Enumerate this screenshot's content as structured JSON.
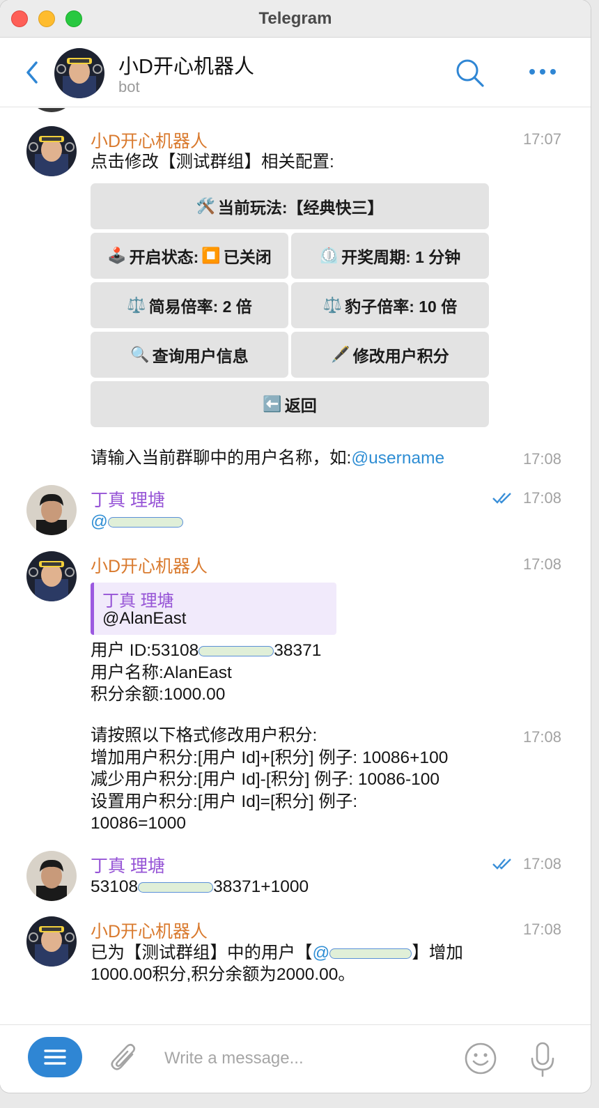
{
  "window": {
    "title": "Telegram"
  },
  "header": {
    "name": "小D开心机器人",
    "status": "bot"
  },
  "messages": {
    "m1": {
      "sender": "小D开心机器人",
      "time": "17:07",
      "text": "点击修改【测试群组】相关配置:",
      "keyboard": {
        "b1": {
          "icon": "🛠️",
          "label": "当前玩法:【经典快三】"
        },
        "b2": {
          "icon": "🕹️",
          "label": "开启状态: ",
          "icon2": "⏹️",
          "label2": "已关闭"
        },
        "b3": {
          "icon": "⏲️",
          "label": "开奖周期: 1 分钟"
        },
        "b4": {
          "icon": "⚖️",
          "label": "简易倍率: 2 倍"
        },
        "b5": {
          "icon": "⚖️",
          "label": "豹子倍率: 10 倍"
        },
        "b6": {
          "icon": "🔍",
          "label": "查询用户信息"
        },
        "b7": {
          "icon": "🖋️",
          "label": "修改用户积分"
        },
        "b8": {
          "icon": "⬅️",
          "label": "返回"
        }
      }
    },
    "m2": {
      "time": "17:08",
      "text": "请输入当前群聊中的用户名称，如:",
      "link": "@username"
    },
    "m3": {
      "sender": "丁真 理塘",
      "time": "17:08",
      "text": "@"
    },
    "m4": {
      "sender": "小D开心机器人",
      "time": "17:08",
      "quote_name": "丁真 理塘",
      "quote_text": "@AlanEast",
      "line1_a": "用户 ID:53108",
      "line1_b": "38371",
      "line2": "用户名称:AlanEast",
      "line3": "积分余额:1000.00"
    },
    "m5": {
      "time": "17:08",
      "lines": [
        "请按照以下格式修改用户积分:",
        "增加用户积分:[用户 Id]+[积分] 例子: 10086+100",
        "减少用户积分:[用户 Id]-[积分] 例子: 10086-100",
        "设置用户积分:[用户 Id]=[积分] 例子:",
        "10086=1000"
      ]
    },
    "m6": {
      "sender": "丁真 理塘",
      "time": "17:08",
      "text_a": "53108",
      "text_b": "38371+1000"
    },
    "m7": {
      "sender": "小D开心机器人",
      "time": "17:08",
      "line1_a": "已为【测试群组】中的用户【",
      "line1_link": "@",
      "line1_b": "】增加",
      "line2": "1000.00积分,积分余额为2000.00。"
    }
  },
  "composer": {
    "placeholder": "Write a message..."
  },
  "colors": {
    "accent": "#2f86d4",
    "bot_name": "#d97a2e",
    "user_name": "#9654d6",
    "button_bg": "#e3e3e3"
  }
}
